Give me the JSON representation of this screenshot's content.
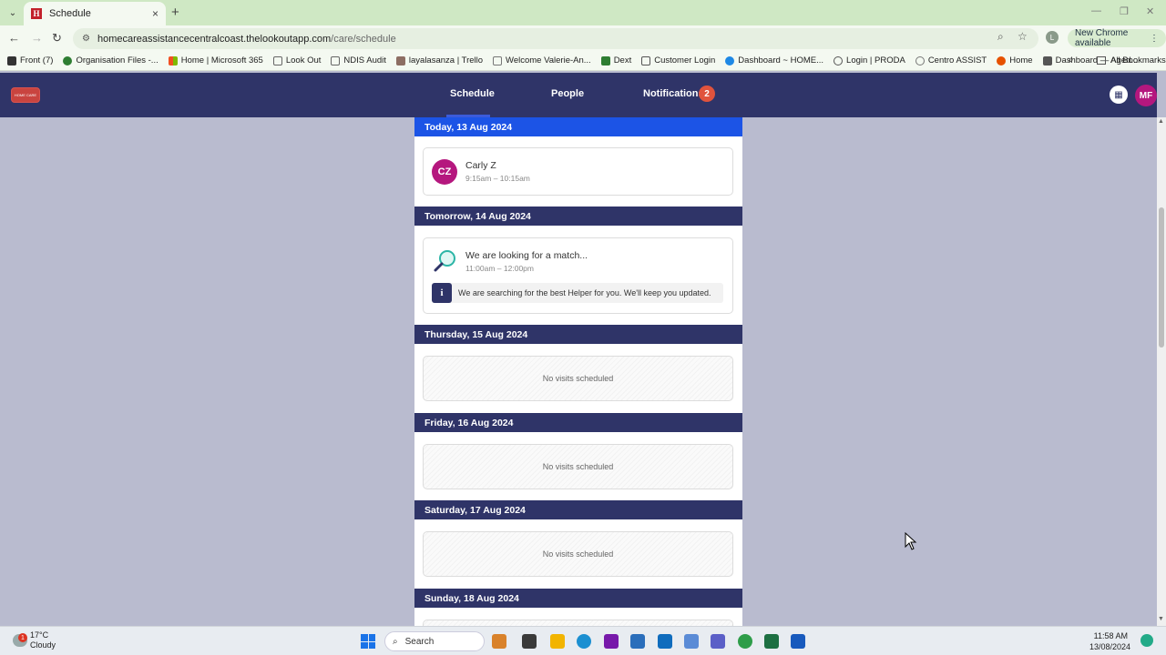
{
  "browser": {
    "tab_title": "Schedule",
    "tab_favicon": "H",
    "url_host": "homecareassistancecentralcoast.thelookoutapp.com",
    "url_path": "/care/schedule",
    "profile_initial": "L",
    "new_chrome_label": "New Chrome available",
    "bookmarks": [
      {
        "label": "Front (7)",
        "icon": "front-icon",
        "color": "#333"
      },
      {
        "label": "Organisation Files -...",
        "icon": "files-icon",
        "color": "#2e7d32"
      },
      {
        "label": "Home | Microsoft 365",
        "icon": "microsoft-icon",
        "color": "#f25022"
      },
      {
        "label": "Look Out",
        "icon": "folder-icon",
        "color": "#666"
      },
      {
        "label": "NDIS Audit",
        "icon": "folder-icon",
        "color": "#666"
      },
      {
        "label": "layalasanza | Trello",
        "icon": "trello-icon",
        "color": "#8d6e63"
      },
      {
        "label": "Welcome Valerie-An...",
        "icon": "doc-icon",
        "color": "#777"
      },
      {
        "label": "Dext",
        "icon": "dext-icon",
        "color": "#2e7d32"
      },
      {
        "label": "Customer Login",
        "icon": "login-icon",
        "color": "#555"
      },
      {
        "label": "Dashboard ~ HOME...",
        "icon": "dashboard-icon",
        "color": "#1e88e5"
      },
      {
        "label": "Login | PRODA",
        "icon": "key-icon",
        "color": "#555"
      },
      {
        "label": "Centro ASSIST",
        "icon": "centro-icon",
        "color": "#777"
      },
      {
        "label": "Home",
        "icon": "home-icon",
        "color": "#e65100"
      },
      {
        "label": "Dashboard — Aged...",
        "icon": "aged-icon",
        "color": "#555"
      }
    ],
    "all_bookmarks_label": "All Bookmarks"
  },
  "app": {
    "nav": {
      "schedule": "Schedule",
      "people": "People",
      "notifications": "Notifications",
      "notifications_count": "2"
    },
    "user_initials": "MF",
    "logo_text": "HOME CARE"
  },
  "schedule": {
    "days": [
      {
        "label": "Today, 13 Aug 2024"
      },
      {
        "label": "Tomorrow, 14 Aug 2024"
      },
      {
        "label": "Thursday, 15 Aug 2024"
      },
      {
        "label": "Friday, 16 Aug 2024"
      },
      {
        "label": "Saturday, 17 Aug 2024"
      },
      {
        "label": "Sunday, 18 Aug 2024"
      }
    ],
    "visit": {
      "initials": "CZ",
      "name": "Carly Z",
      "time": "9:15am – 10:15am"
    },
    "match": {
      "title": "We are looking for a match...",
      "time": "11:00am – 12:00pm",
      "info": "We are searching for the best Helper for you. We'll keep you updated."
    },
    "empty_text": "No visits scheduled"
  },
  "taskbar": {
    "temperature": "17°C",
    "condition": "Cloudy",
    "weather_badge": "1",
    "search_label": "Search",
    "time": "11:58 AM",
    "date": "13/08/2024"
  }
}
